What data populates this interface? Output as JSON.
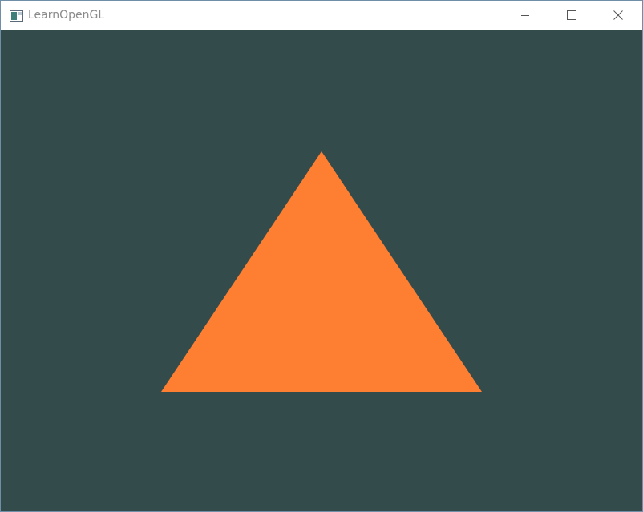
{
  "window": {
    "title": "LearnOpenGL",
    "icon": "app-window-icon",
    "buttons": {
      "minimize": "minimize-icon",
      "maximize": "maximize-icon",
      "close": "close-icon"
    }
  },
  "viewport": {
    "clear_color": "#344b4b",
    "shape": "triangle",
    "triangle_color": "#fe7f32"
  }
}
